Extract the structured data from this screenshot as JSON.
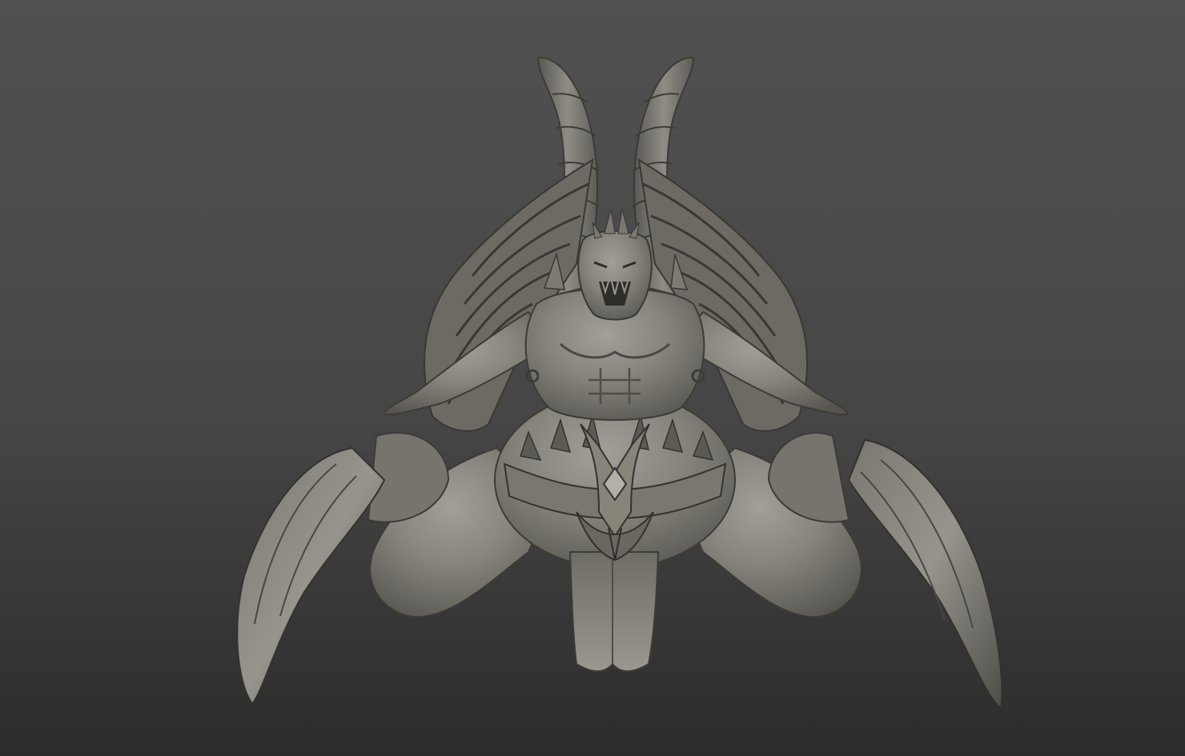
{
  "scene": {
    "subject_icon": "demon-sculpt-icon",
    "colors": {
      "background_top": "#515151",
      "background_bottom": "#2c2c2c",
      "clay_light": "#8d8a83",
      "clay_mid": "#6e6b65",
      "clay_dark": "#4a4844",
      "clay_shadow": "#35332f",
      "clay_highlight": "#a29f98"
    }
  }
}
